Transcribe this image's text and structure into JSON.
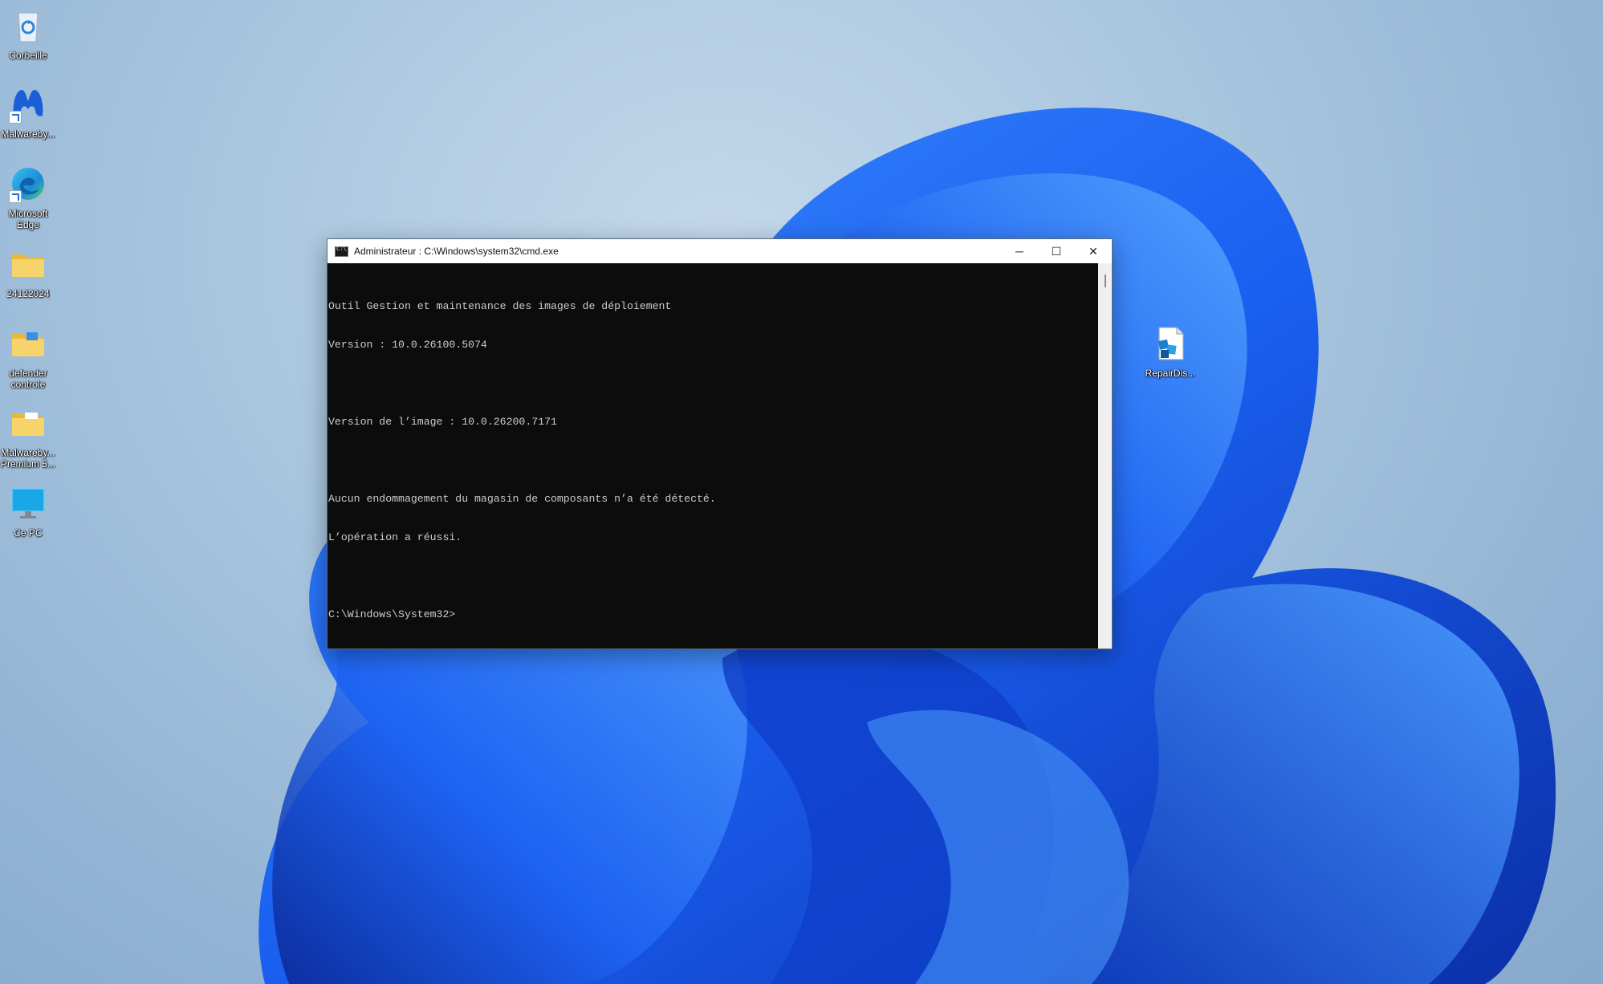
{
  "desktop": {
    "icons": [
      {
        "label": "Corbeille",
        "icon": "recycle-bin-icon"
      },
      {
        "label": "Malwareby...",
        "icon": "malwarebytes-icon"
      },
      {
        "label": "Microsoft Edge",
        "icon": "edge-icon"
      },
      {
        "label": "24122024",
        "icon": "folder-icon"
      },
      {
        "label": "defender controle",
        "icon": "folder-icon"
      },
      {
        "label": "Malwareby... Premium 5...",
        "icon": "folder-icon"
      },
      {
        "label": "Ce PC",
        "icon": "computer-icon"
      },
      {
        "label": "RepairDis...",
        "icon": "script-file-icon"
      }
    ]
  },
  "cmd_window": {
    "title": "Administrateur : C:\\Windows\\system32\\cmd.exe",
    "controls": {
      "minimize": "─",
      "maximize": "☐",
      "close": "✕"
    },
    "lines": [
      "Outil Gestion et maintenance des images de déploiement",
      "Version : 10.0.26100.5074",
      "",
      "Version de l’image : 10.0.26200.7171",
      "",
      "Aucun endommagement du magasin de composants n’a été détecté.",
      "L’opération a réussi.",
      "",
      "C:\\Windows\\System32>"
    ]
  },
  "colors": {
    "console_bg": "#0c0c0c",
    "console_text": "#cccccc",
    "titlebar_bg": "#ffffff",
    "bloom_blue": "#1a5ff0"
  }
}
